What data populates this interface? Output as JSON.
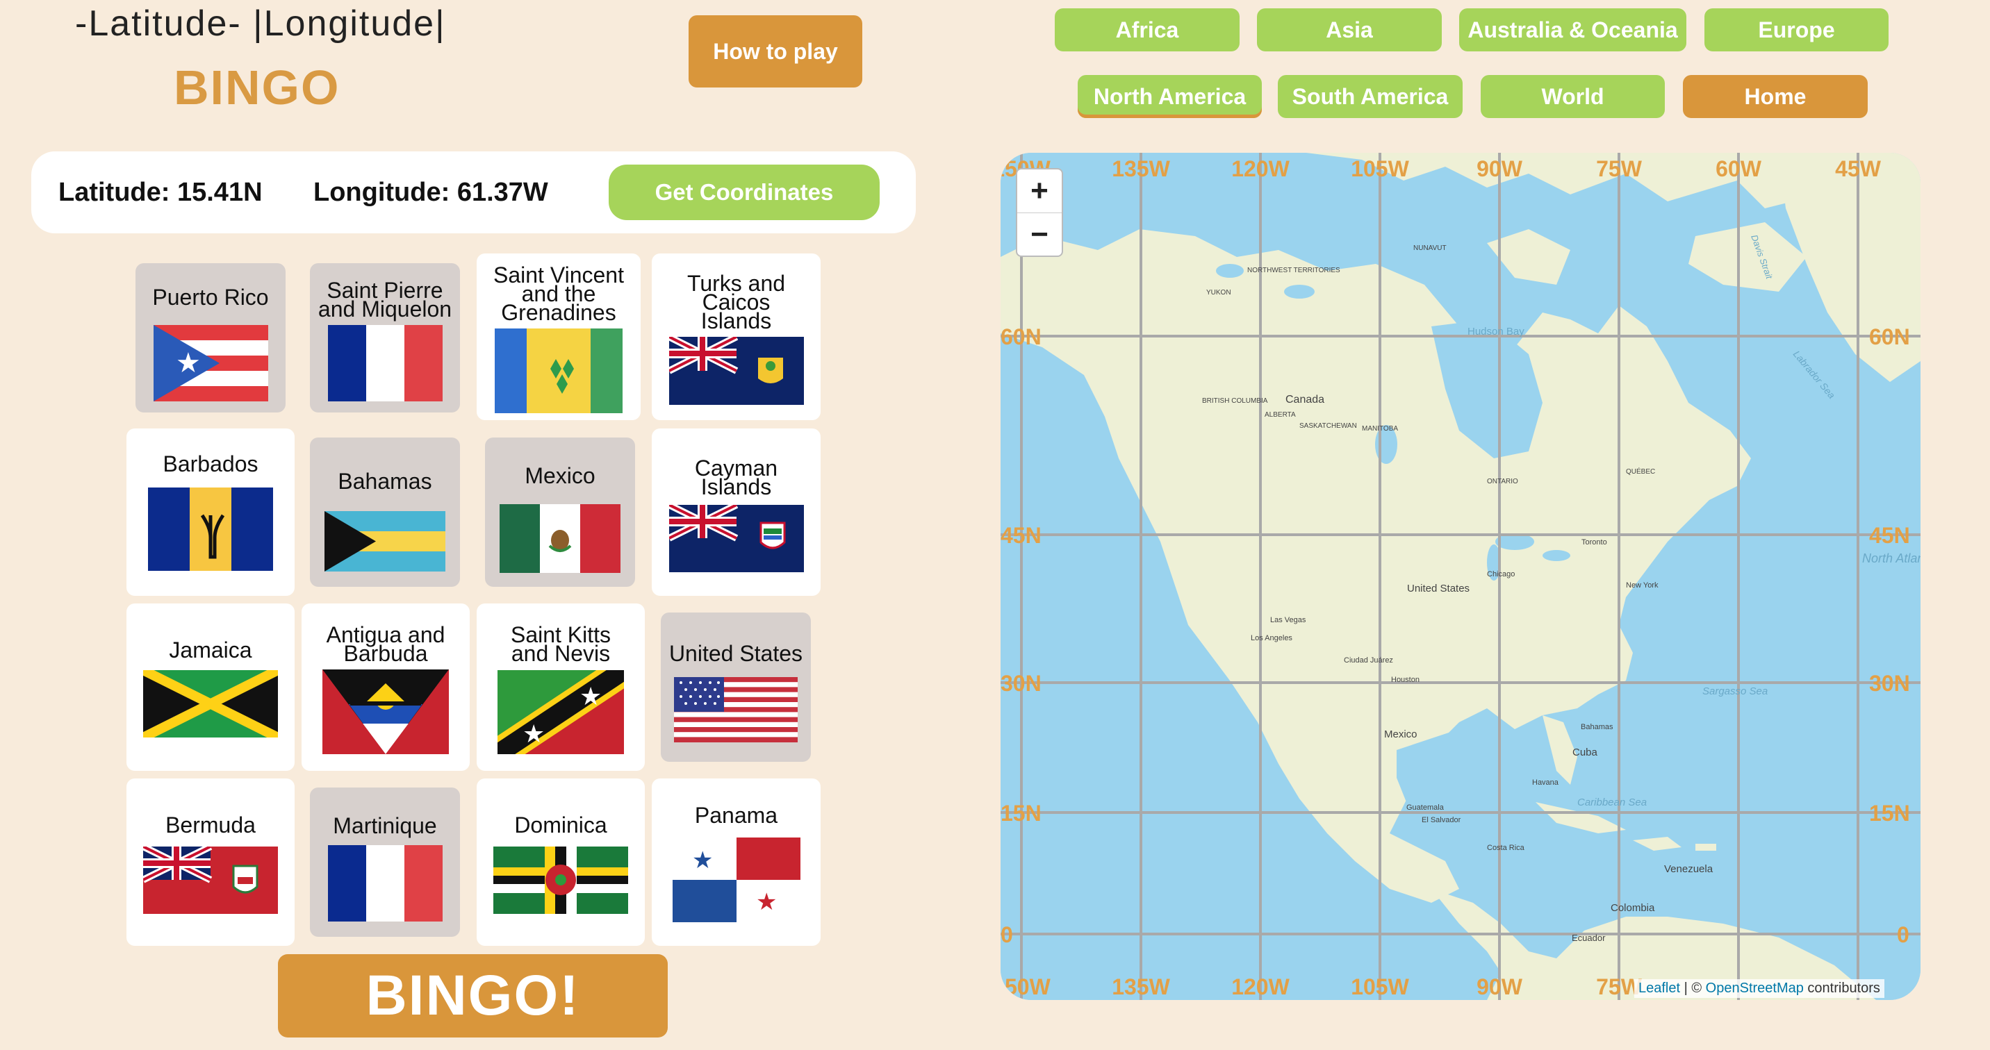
{
  "header": {
    "title_line1": "-Latitude- |Longitude|",
    "title_line2": "BINGO",
    "how_to_play": "How to play"
  },
  "nav": {
    "row1": [
      "Africa",
      "Asia",
      "Australia & Oceania",
      "Europe"
    ],
    "row2": [
      "North America",
      "South America",
      "World",
      "Home"
    ],
    "active": "North America"
  },
  "coords": {
    "latitude": "Latitude: 15.41N",
    "longitude": "Longitude: 61.37W",
    "get_button": "Get Coordinates"
  },
  "cards": [
    {
      "name": "Puerto Rico",
      "flag": "puerto-rico-flag",
      "marked": true
    },
    {
      "name": "Saint Pierre\nand Miquelon",
      "flag": "saint-pierre-miquelon-flag",
      "marked": true
    },
    {
      "name": "Saint Vincent\nand the\nGrenadines",
      "flag": "saint-vincent-flag",
      "marked": false
    },
    {
      "name": "Turks and\nCaicos\nIslands",
      "flag": "turks-caicos-flag",
      "marked": false
    },
    {
      "name": "Barbados",
      "flag": "barbados-flag",
      "marked": false
    },
    {
      "name": "Bahamas",
      "flag": "bahamas-flag",
      "marked": true
    },
    {
      "name": "Mexico",
      "flag": "mexico-flag",
      "marked": true
    },
    {
      "name": "Cayman\nIslands",
      "flag": "cayman-flag",
      "marked": false
    },
    {
      "name": "Jamaica",
      "flag": "jamaica-flag",
      "marked": false
    },
    {
      "name": "Antigua and\nBarbuda",
      "flag": "antigua-flag",
      "marked": false
    },
    {
      "name": "Saint Kitts\nand Nevis",
      "flag": "saint-kitts-flag",
      "marked": false
    },
    {
      "name": "United States",
      "flag": "usa-flag",
      "marked": true
    },
    {
      "name": "Bermuda",
      "flag": "bermuda-flag",
      "marked": false
    },
    {
      "name": "Martinique",
      "flag": "martinique-flag",
      "marked": true
    },
    {
      "name": "Dominica",
      "flag": "dominica-flag",
      "marked": false
    },
    {
      "name": "Panama",
      "flag": "panama-flag",
      "marked": false
    }
  ],
  "bingo_button": "BINGO!",
  "map": {
    "zoom_in": "+",
    "zoom_out": "−",
    "lon_labels": [
      "135W",
      "120W",
      "105W",
      "90W",
      "75W",
      "60W",
      "45W"
    ],
    "lat_labels": [
      "60N",
      "45N",
      "30N",
      "15N",
      "0"
    ],
    "places": [
      "Canada",
      "United States",
      "Mexico",
      "Cuba",
      "Colombia",
      "Venezuela",
      "Ecuador",
      "Hudson Bay",
      "BRITISH COLUMBIA",
      "ALBERTA",
      "SASKATCHEWAN",
      "MANITOBA",
      "ONTARIO",
      "QUÉBEC",
      "NUNAVUT",
      "NORTHWEST TERRITORIES",
      "YUKON",
      "Havana",
      "Bahamas",
      "Guatemala",
      "El Salvador",
      "Costa Rica",
      "Los Angeles",
      "Las Vegas",
      "Chicago",
      "New York",
      "Toronto",
      "Houston",
      "Ciudad Juárez",
      "Sargasso Sea",
      "Labrador Sea",
      "North Atlantic Ocean",
      "Caribbean Sea",
      "Davis Strait"
    ],
    "attribution_link1": "Leaflet",
    "attribution_sep": " | © ",
    "attribution_link2": "OpenStreetMap",
    "attribution_tail": " contributors"
  },
  "colors": {
    "background": "#f8ebdb",
    "accent_orange": "#d9963b",
    "accent_green": "#a6d45a",
    "card_marked": "#d7d0cd",
    "water": "#9ad3ee",
    "land": "#eef0d6",
    "grid": "#a9a9a9",
    "grid_label": "#e3a046"
  }
}
